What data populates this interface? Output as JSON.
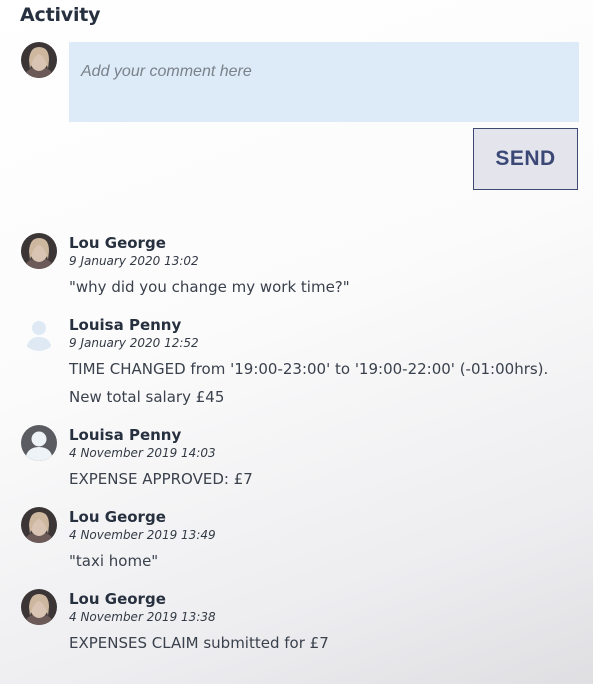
{
  "header": {
    "title": "Activity"
  },
  "composer": {
    "placeholder": "Add your comment here",
    "send_label": "SEND"
  },
  "activity": [
    {
      "name": "Lou George",
      "time": "9 January 2020 13:02",
      "message": "\"why did you change my work time?\"",
      "avatar": "photo"
    },
    {
      "name": "Louisa Penny",
      "time": "9 January 2020 12:52",
      "message": "TIME CHANGED from '19:00-23:00' to '19:00-22:00' (-01:00hrs). New total salary £45",
      "avatar": "placeholder-light"
    },
    {
      "name": "Louisa Penny",
      "time": "4 November 2019 14:03",
      "message": "EXPENSE APPROVED: £7",
      "avatar": "placeholder-dark"
    },
    {
      "name": "Lou George",
      "time": "4 November 2019 13:49",
      "message": "\"taxi home\"",
      "avatar": "photo"
    },
    {
      "name": "Lou George",
      "time": "4 November 2019 13:38",
      "message": "EXPENSES CLAIM submitted for £7",
      "avatar": "photo"
    }
  ]
}
